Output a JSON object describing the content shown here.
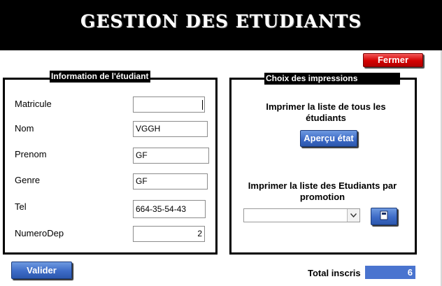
{
  "header": {
    "title": "GESTION DES ETUDIANTS"
  },
  "close_button": {
    "label": "Fermer"
  },
  "student_info": {
    "title": "Information de l'étudiant",
    "fields": {
      "matricule": {
        "label": "Matricule",
        "value": ""
      },
      "nom": {
        "label": "Nom",
        "value": "VGGH"
      },
      "prenom": {
        "label": "Prenom",
        "value": "GF"
      },
      "genre": {
        "label": "Genre",
        "value": "GF"
      },
      "tel": {
        "label": "Tel",
        "value": "664-35-54-43"
      },
      "numerodep": {
        "label": "NumeroDep",
        "value": "2"
      }
    }
  },
  "print_choices": {
    "title": "Choix des impressions",
    "all_students_text": "Imprimer la liste de tous les étudiants",
    "preview_button": "Aperçu état",
    "by_promotion_text": "Imprimer la liste des Etudiants par promotion",
    "promotion_select_value": ""
  },
  "validate_button": {
    "label": "Valider"
  },
  "total": {
    "label": "Total inscris",
    "value": "6"
  },
  "colors": {
    "header_bg": "#000000",
    "close_red": "#d40000",
    "button_blue": "#3d6bc7",
    "total_bg": "#4a74cf"
  }
}
